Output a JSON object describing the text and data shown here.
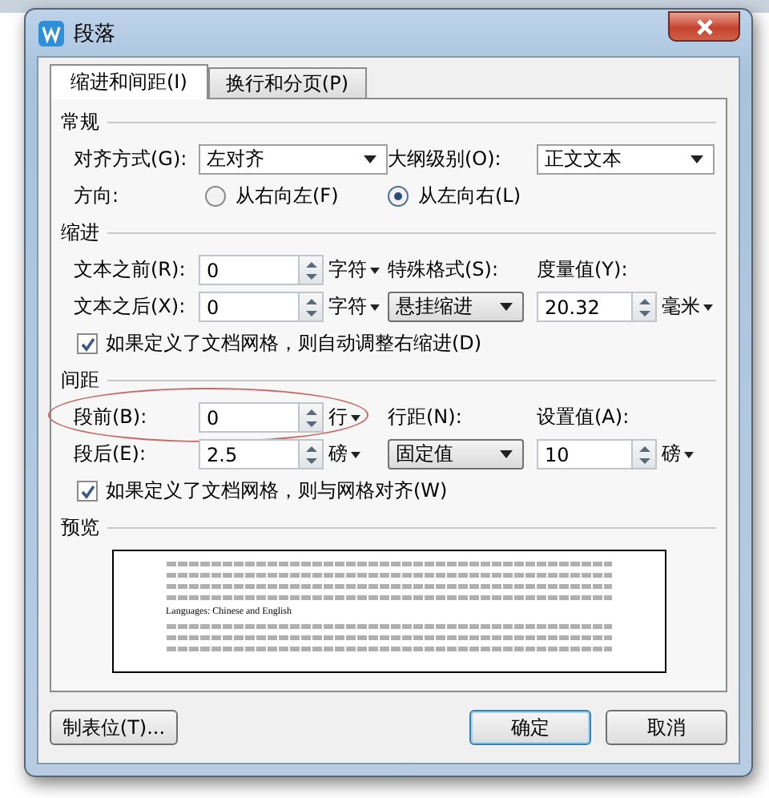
{
  "window": {
    "title": "段落"
  },
  "tabs": [
    {
      "label": "缩进和间距(I)",
      "selected": true
    },
    {
      "label": "换行和分页(P)",
      "selected": false
    }
  ],
  "sections": [
    {
      "title": "常规",
      "rows": [
        {
          "cells": [
            {
              "kind": "label",
              "text": "对齐方式(G):"
            },
            {
              "kind": "select",
              "value": "左对齐"
            },
            {
              "kind": "label",
              "text": "大纲级别(O):"
            },
            {
              "kind": "select",
              "value": "正文文本"
            }
          ]
        },
        {
          "cells": [
            {
              "kind": "label",
              "text": "方向:"
            },
            {
              "kind": "radio",
              "text": "从右向左(F)",
              "selected": false
            },
            {
              "kind": "radio",
              "text": "从左向右(L)",
              "selected": true
            }
          ]
        }
      ]
    },
    {
      "title": "缩进",
      "rows": [
        {
          "cells": [
            {
              "kind": "label",
              "text": "文本之前(R):"
            },
            {
              "kind": "spin",
              "value": "0"
            },
            {
              "kind": "unit",
              "text": "字符"
            },
            {
              "kind": "label",
              "text": "特殊格式(S):"
            },
            {
              "kind": "label",
              "text": "度量值(Y):"
            }
          ]
        },
        {
          "cells": [
            {
              "kind": "label",
              "text": "文本之后(X):"
            },
            {
              "kind": "spin",
              "value": "0"
            },
            {
              "kind": "unit",
              "text": "字符"
            },
            {
              "kind": "combo",
              "value": "悬挂缩进"
            },
            {
              "kind": "spin",
              "value": "20.32"
            },
            {
              "kind": "unit",
              "text": "毫米"
            }
          ]
        },
        {
          "cells": [
            {
              "kind": "check",
              "text": "如果定义了文档网格，则自动调整右缩进(D)",
              "checked": true
            }
          ]
        }
      ]
    },
    {
      "title": "间距",
      "rows": [
        {
          "highlighted": true,
          "cells": [
            {
              "kind": "label",
              "text": "段前(B):"
            },
            {
              "kind": "spin",
              "value": "0"
            },
            {
              "kind": "unit",
              "text": "行"
            },
            {
              "kind": "label",
              "text": "行距(N):"
            },
            {
              "kind": "label",
              "text": "设置值(A):"
            }
          ]
        },
        {
          "cells": [
            {
              "kind": "label",
              "text": "段后(E):"
            },
            {
              "kind": "spin",
              "value": "2.5"
            },
            {
              "kind": "unit",
              "text": "磅"
            },
            {
              "kind": "combo",
              "value": "固定值"
            },
            {
              "kind": "spin",
              "value": "10"
            },
            {
              "kind": "unit",
              "text": "磅"
            }
          ]
        },
        {
          "cells": [
            {
              "kind": "check",
              "text": "如果定义了文档网格，则与网格对齐(W)",
              "checked": true
            }
          ]
        }
      ]
    }
  ],
  "preview": {
    "title": "预览",
    "sample": "Languages: Chinese and English"
  },
  "buttons": [
    {
      "label": "制表位(T)...",
      "default": false
    },
    {
      "label": "确定",
      "default": true
    },
    {
      "label": "取消",
      "default": false
    }
  ]
}
